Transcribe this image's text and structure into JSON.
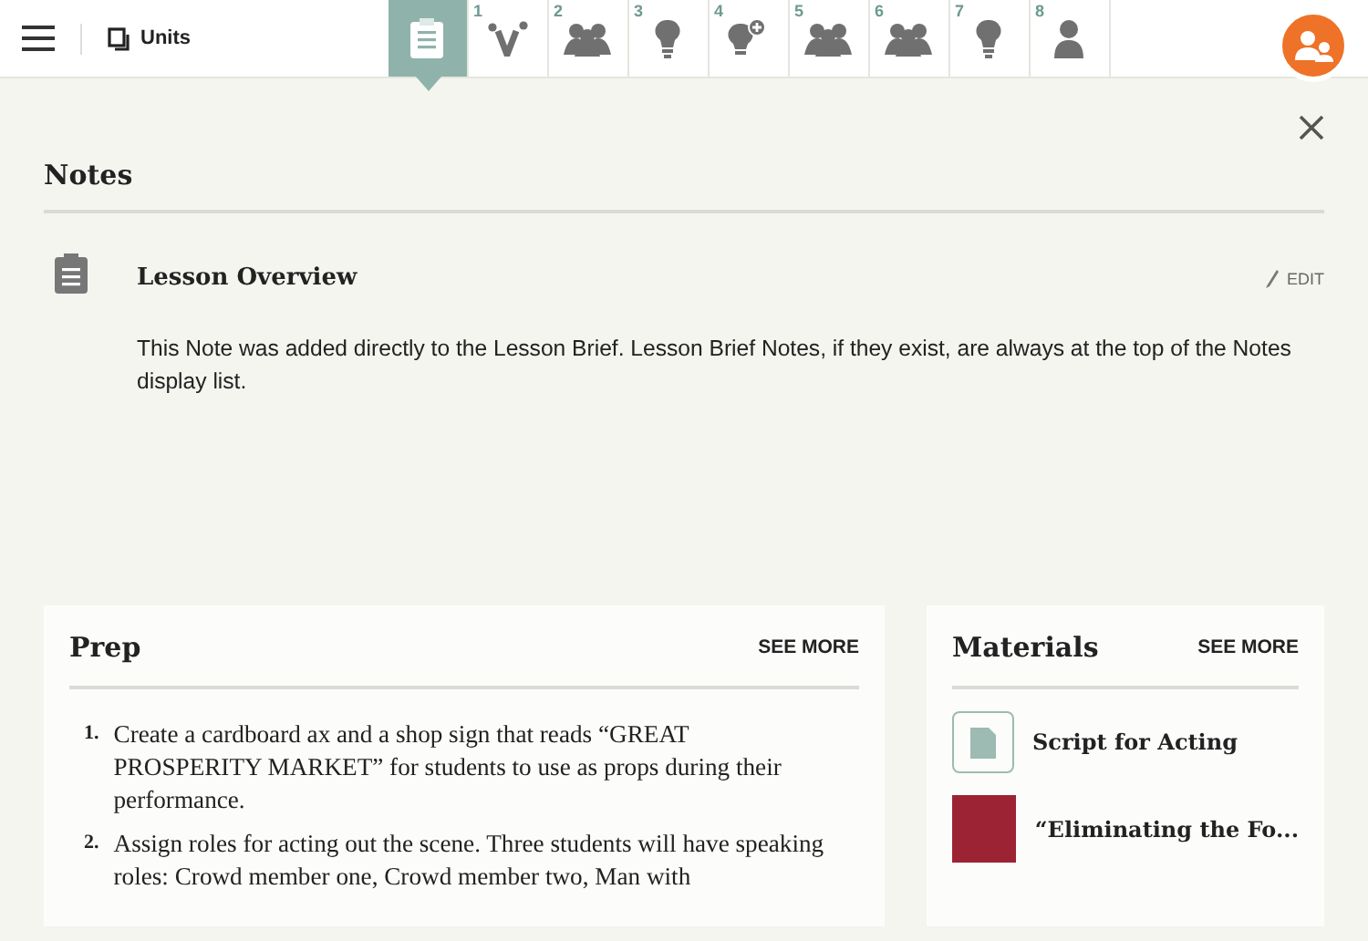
{
  "top_bar": {
    "units_label": "Units"
  },
  "lesson_tabs": [
    {
      "kind": "notes",
      "selected": true
    },
    {
      "number": "1",
      "kind": "vocab",
      "selected": false
    },
    {
      "number": "2",
      "kind": "group",
      "selected": false
    },
    {
      "number": "3",
      "kind": "bulb",
      "selected": false
    },
    {
      "number": "4",
      "kind": "bulb-plus",
      "selected": false
    },
    {
      "number": "5",
      "kind": "group",
      "selected": false
    },
    {
      "number": "6",
      "kind": "group",
      "selected": false
    },
    {
      "number": "7",
      "kind": "bulb",
      "selected": false
    },
    {
      "number": "8",
      "kind": "person",
      "selected": false
    }
  ],
  "notes": {
    "title": "Notes",
    "items": [
      {
        "title": "Lesson Overview",
        "edit_label": "EDIT",
        "body": "This Note was added directly to the Lesson Brief.  Lesson Brief Notes, if they exist, are always at the top of the Notes display list."
      }
    ]
  },
  "prep": {
    "title": "Prep",
    "see_more": "SEE MORE",
    "steps": [
      {
        "number": "1.",
        "text": "Create a cardboard ax and a shop sign that reads “GREAT PROSPERITY MARKET” for students to use as props during their performance."
      },
      {
        "number": "2.",
        "text": "Assign roles for acting out the scene. Three students will have speaking roles: Crowd member one, Crowd member two, Man with"
      }
    ]
  },
  "materials": {
    "title": "Materials",
    "see_more": "SEE MORE",
    "items": [
      {
        "kind": "pdf",
        "title": "Script for Acting"
      },
      {
        "kind": "image",
        "title": "“Eliminating the Fo..."
      }
    ]
  }
}
